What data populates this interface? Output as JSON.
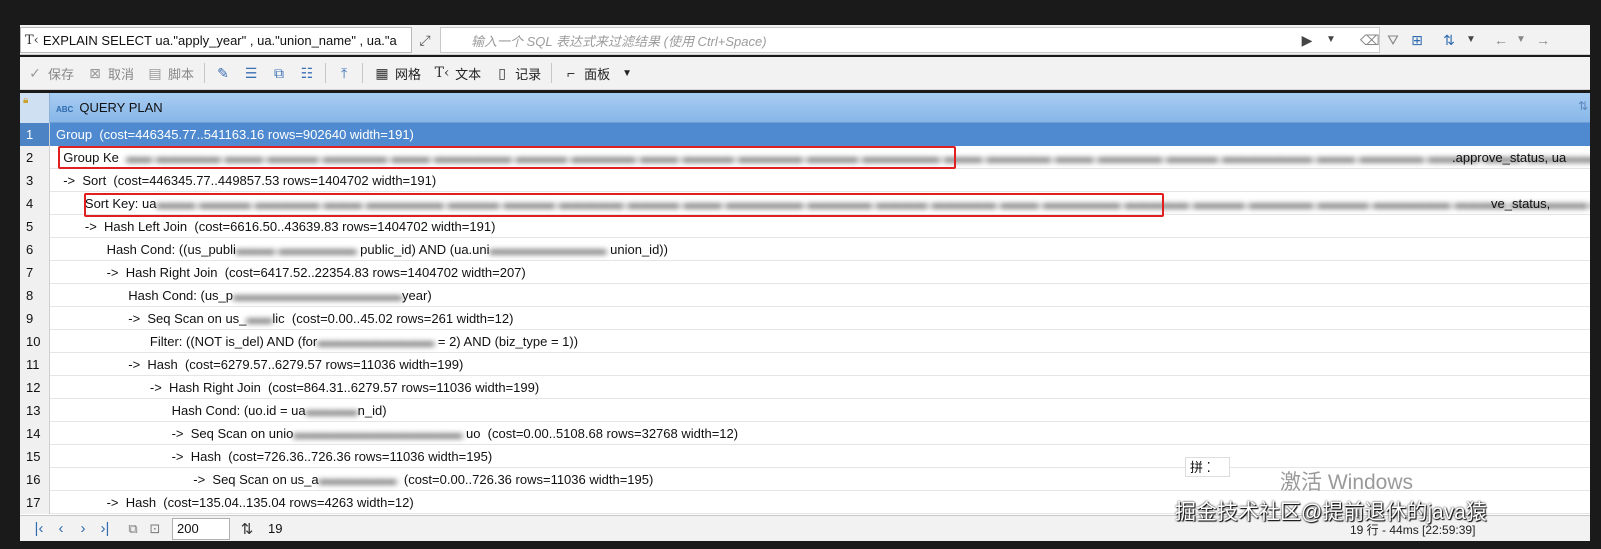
{
  "query_bar": {
    "sql_text": "EXPLAIN SELECT ua.\"apply_year\" , ua.\"union_name\" , ua.\"a",
    "filter_placeholder": "输入一个 SQL 表达式来过滤结果 (使用 Ctrl+Space)"
  },
  "toolbar": {
    "save": "保存",
    "cancel": "取消",
    "script": "脚本",
    "grid": "网格",
    "text": "文本",
    "record": "记录",
    "panel": "面板"
  },
  "grid": {
    "column_header": "QUERY PLAN",
    "rows": [
      {
        "num": "1",
        "text": "Group  (cost=446345.77..541163.16 rows=902640 width=191)"
      },
      {
        "num": "2",
        "text": "  Group Ke",
        "tail": ".approve_status, ua"
      },
      {
        "num": "3",
        "text": "  ->  Sort  (cost=446345.77..449857.53 rows=1404702 width=191)"
      },
      {
        "num": "4",
        "text": "        Sort Key: ua",
        "tail": "ve_status,"
      },
      {
        "num": "5",
        "text": "        ->  Hash Left Join  (cost=6616.50..43639.83 rows=1404702 width=191)"
      },
      {
        "num": "6",
        "text": "              Hash Cond: ((us_publi",
        "mid": "public_id) AND (ua.uni",
        "end": "union_id))"
      },
      {
        "num": "7",
        "text": "              ->  Hash Right Join  (cost=6417.52..22354.83 rows=1404702 width=207)"
      },
      {
        "num": "8",
        "text": "                    Hash Cond: (us_p",
        "end": "year)"
      },
      {
        "num": "9",
        "text": "                    ->  Seq Scan on us_",
        "end": "lic  (cost=0.00..45.02 rows=261 width=12)"
      },
      {
        "num": "10",
        "text": "                          Filter: ((NOT is_del) AND (for",
        "end": " = 2) AND (biz_type = 1))"
      },
      {
        "num": "11",
        "text": "                    ->  Hash  (cost=6279.57..6279.57 rows=11036 width=199)"
      },
      {
        "num": "12",
        "text": "                          ->  Hash Right Join  (cost=864.31..6279.57 rows=11036 width=199)"
      },
      {
        "num": "13",
        "text": "                                Hash Cond: (uo.id = ua",
        "end": "n_id)"
      },
      {
        "num": "14",
        "text": "                                ->  Seq Scan on unio",
        "end": " uo  (cost=0.00..5108.68 rows=32768 width=12)"
      },
      {
        "num": "15",
        "text": "                                ->  Hash  (cost=726.36..726.36 rows=11036 width=195)"
      },
      {
        "num": "16",
        "text": "                                      ->  Seq Scan on us_a",
        "end": "  (cost=0.00..726.36 rows=11036 width=195)"
      },
      {
        "num": "17",
        "text": "              ->  Hash  (cost=135.04..135.04 rows=4263 width=12)"
      }
    ]
  },
  "bottom_bar": {
    "fetch_size": "200",
    "row_count": "19",
    "status": "19 行 - 44ms [22:59:39]"
  },
  "overlays": {
    "ime": "拼 ⁚",
    "windows_watermark": "激活 Windows",
    "site_watermark": "掘金技术社区@提前退休的java猿"
  }
}
